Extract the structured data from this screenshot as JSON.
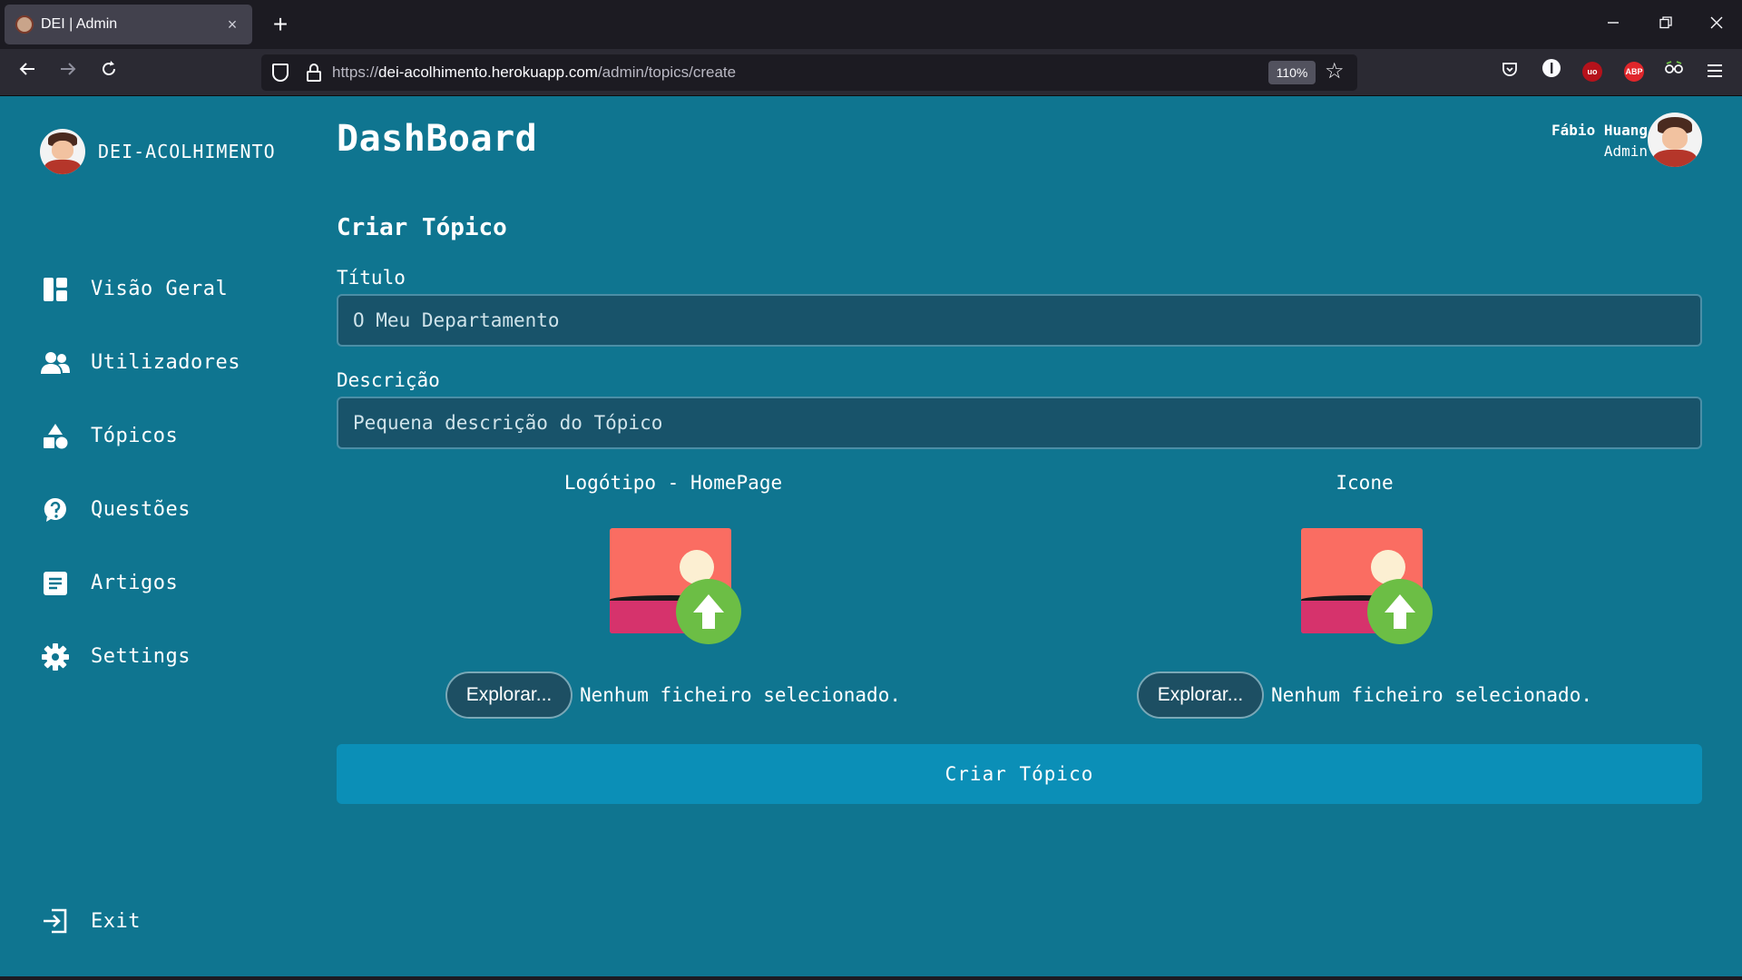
{
  "browser": {
    "tab_title": "DEI | Admin",
    "tab_close": "×",
    "new_tab": "+",
    "url_prefix": "https://",
    "url_host": "dei-acolhimento.herokuapp.com",
    "url_path": "/admin/topics/create",
    "zoom": "110%",
    "extensions": [
      {
        "icon": "uorigin-icon",
        "label": "uo",
        "color": "#b5121b"
      },
      {
        "icon": "abp-icon",
        "label": "ABP",
        "color": "#e0262b"
      }
    ]
  },
  "sidebar": {
    "brand": "DEI-ACOLHIMENTO",
    "items": [
      {
        "label": "Visão Geral",
        "icon": "dashboard-icon"
      },
      {
        "label": "Utilizadores",
        "icon": "users-icon"
      },
      {
        "label": "Tópicos",
        "icon": "shapes-icon"
      },
      {
        "label": "Questões",
        "icon": "question-icon"
      },
      {
        "label": "Artigos",
        "icon": "article-icon"
      },
      {
        "label": "Settings",
        "icon": "gear-icon"
      }
    ],
    "exit_label": "Exit"
  },
  "header": {
    "title": "DashBoard",
    "user_name": "Fábio Huang",
    "user_role": "Admin"
  },
  "form": {
    "section_title": "Criar Tópico",
    "title_label": "Título",
    "title_placeholder": "O Meu Departamento",
    "description_label": "Descrição",
    "description_placeholder": "Pequena descrição do Tópico",
    "uploads": [
      {
        "label": "Logótipo - HomePage",
        "button": "Explorar...",
        "status": "Nenhum ficheiro selecionado."
      },
      {
        "label": "Icone",
        "button": "Explorar...",
        "status": "Nenhum ficheiro selecionado."
      }
    ],
    "submit_label": "Criar Tópico"
  },
  "colors": {
    "background": "#0f7590",
    "submit": "#0b8fb7",
    "input": "#18536a"
  }
}
